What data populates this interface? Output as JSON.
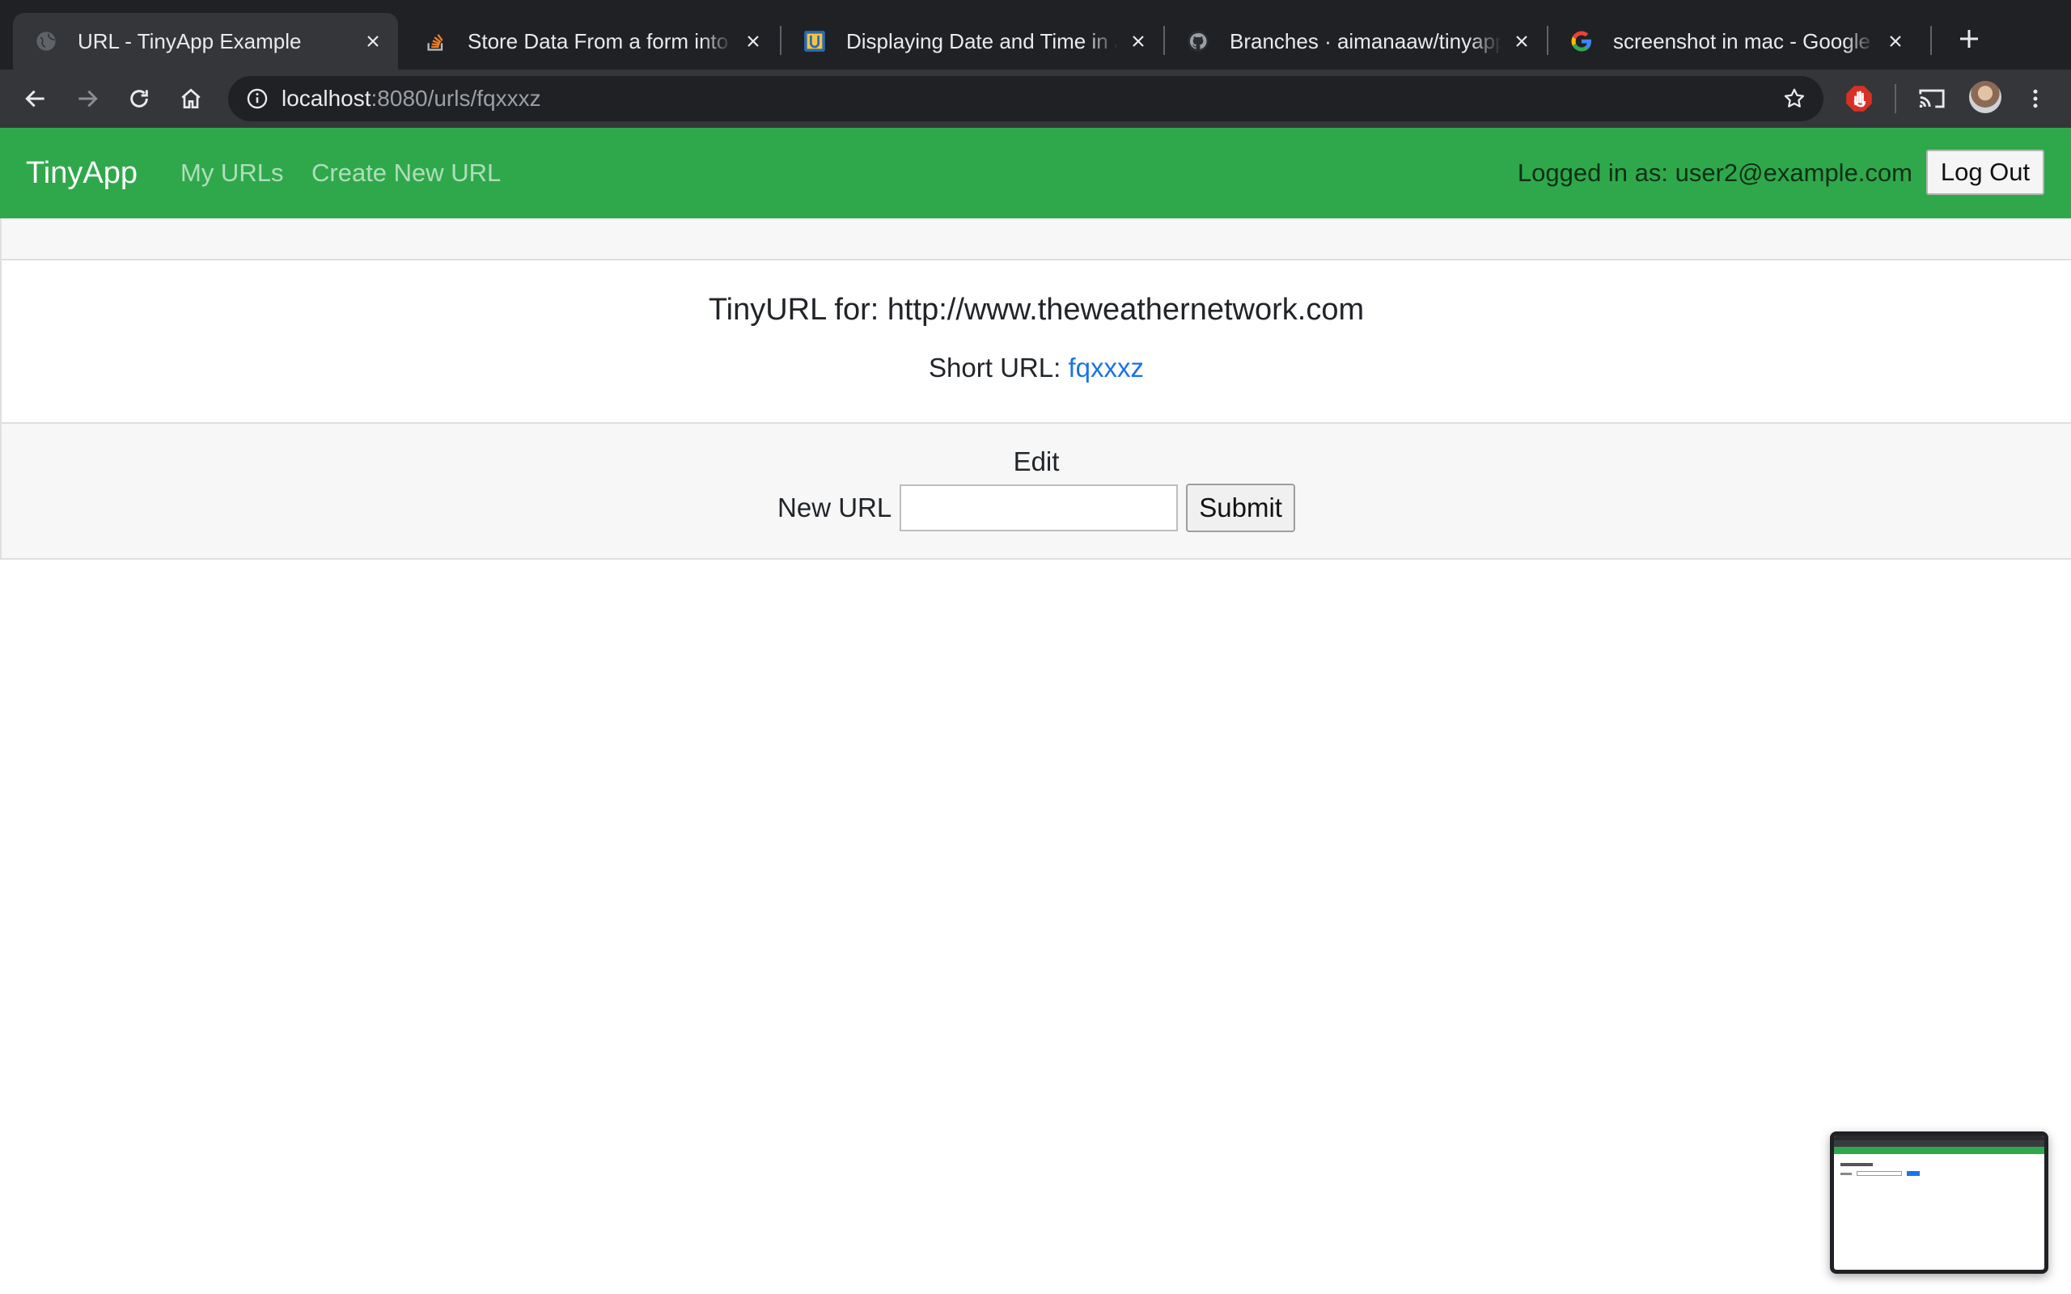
{
  "browser": {
    "tabs": [
      {
        "title": "URL - TinyApp Example",
        "icon": "globe-icon",
        "active": true
      },
      {
        "title": "Store Data From a form into a JavaScript",
        "icon": "stackoverflow-icon",
        "active": false
      },
      {
        "title": "Displaying Date and Time in JavaScript",
        "icon": "u-square-icon",
        "active": false
      },
      {
        "title": "Branches · aimanaaw/tinyapp",
        "icon": "github-icon",
        "active": false
      },
      {
        "title": "screenshot in mac - Google Search",
        "icon": "google-icon",
        "active": false
      }
    ],
    "address": {
      "host": "localhost",
      "path": ":8080/urls/fqxxxz"
    }
  },
  "navbar": {
    "brand": "TinyApp",
    "links": [
      "My URLs",
      "Create New URL"
    ],
    "logged_in_text": "Logged in as: user2@example.com",
    "logout_label": "Log Out",
    "color": "#2fa84b"
  },
  "card": {
    "title": "TinyURL for: http://www.theweathernetwork.com",
    "short_label": "Short URL:",
    "short_value": "fqxxxz",
    "edit_label": "Edit",
    "new_url_label": "New URL",
    "new_url_value": "",
    "submit_label": "Submit",
    "link_color": "#1a73e8"
  }
}
